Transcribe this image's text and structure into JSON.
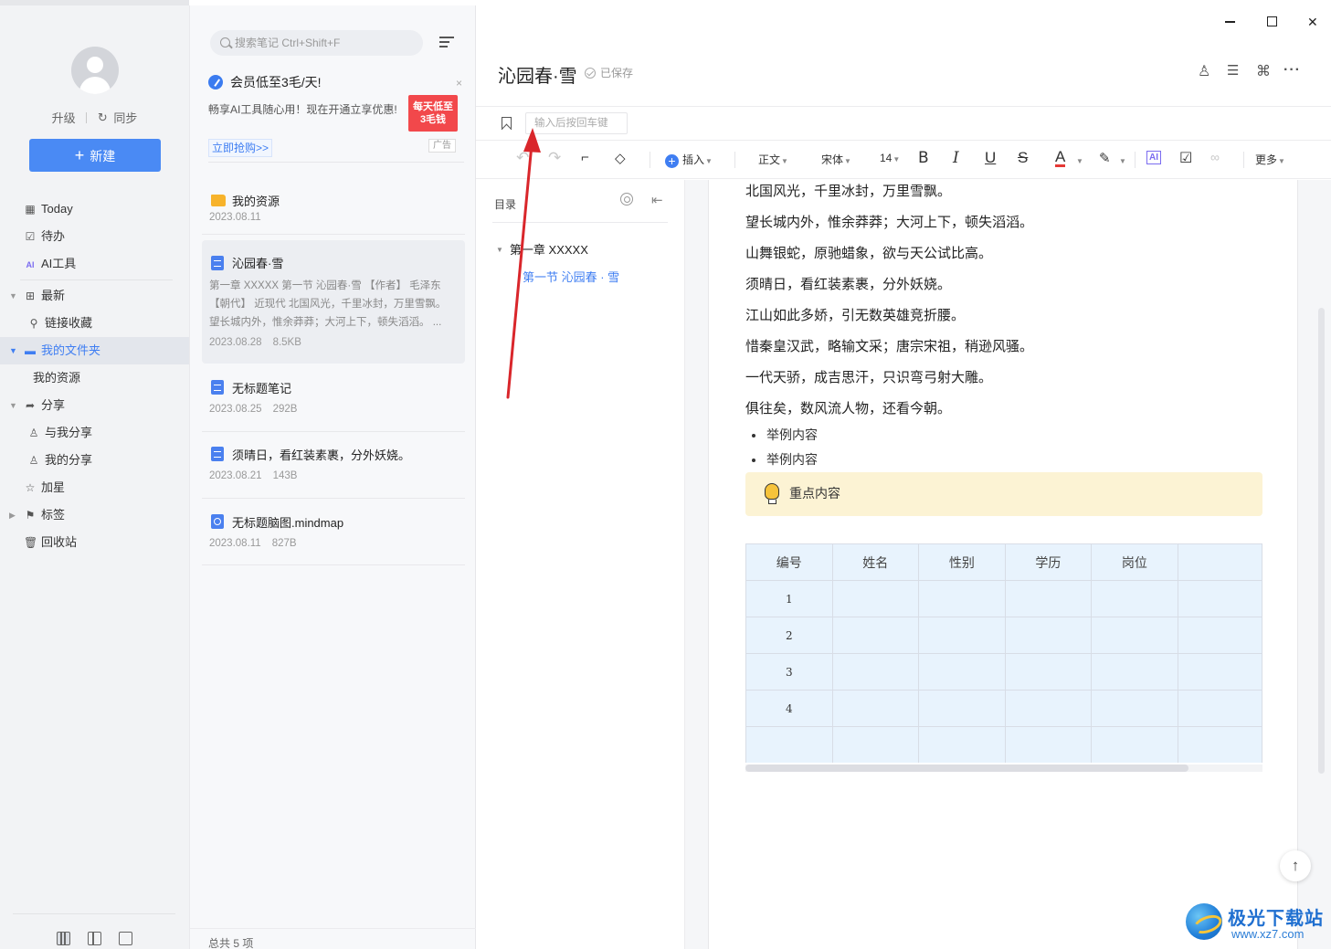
{
  "nav": {
    "upgrade": "升级",
    "sync": "同步",
    "new_label": "新建",
    "items": [
      {
        "label": "Today",
        "icon": "calendar-icon"
      },
      {
        "label": "待办",
        "icon": "checkbox-icon"
      },
      {
        "label": "AI工具",
        "icon": "ai-icon"
      },
      {
        "label": "最新",
        "icon": "grid-icon"
      },
      {
        "label": "链接收藏",
        "icon": "link-icon"
      },
      {
        "label": "我的文件夹",
        "icon": "folder-icon"
      },
      {
        "label": "我的资源",
        "icon": ""
      },
      {
        "label": "分享",
        "icon": "share-icon"
      },
      {
        "label": "与我分享",
        "icon": "user-icon"
      },
      {
        "label": "我的分享",
        "icon": "user-icon"
      },
      {
        "label": "加星",
        "icon": "star-icon"
      },
      {
        "label": "标签",
        "icon": "bookmark-icon"
      },
      {
        "label": "回收站",
        "icon": "trash-icon"
      }
    ]
  },
  "list": {
    "search_placeholder": "搜索笔记 Ctrl+Shift+F",
    "promo": {
      "title": "会员低至3毛/天!",
      "text": "畅享AI工具随心用！现在开通立享优惠!",
      "link": "立即抢购>>",
      "badge_line1": "每天低至",
      "badge_line2": "3毛钱",
      "ad": "广告",
      "close": "×"
    },
    "notes": [
      {
        "title": "我的资源",
        "date": "2023.08.11",
        "size": "",
        "body": ""
      },
      {
        "title": "沁园春·雪",
        "date": "2023.08.28",
        "size": "8.5KB",
        "body": "第一章 XXXXX 第一节 沁园春·雪 【作者】 毛泽东 【朝代】 近现代 北国风光，千里冰封，万里雪飘。望长城内外，惟余莽莽；大河上下，顿失滔滔。 ..."
      },
      {
        "title": "无标题笔记",
        "date": "2023.08.25",
        "size": "292B",
        "body": ""
      },
      {
        "title": "须晴日，看红装素裹，分外妖娆。",
        "date": "2023.08.21",
        "size": "143B",
        "body": ""
      },
      {
        "title": "无标题脑图.mindmap",
        "date": "2023.08.11",
        "size": "827B",
        "body": ""
      }
    ],
    "total": "总共 5 项"
  },
  "editor": {
    "title": "沁园春·雪",
    "saved": "已保存",
    "tag_placeholder": "输入后按回车键",
    "toolbar": {
      "insert": "插入",
      "paragraph": "正文",
      "font": "宋体",
      "size": "14",
      "more": "更多"
    },
    "toc": {
      "title": "目录",
      "h1": "第一章  XXXXX",
      "h2": "第一节 沁园春 · 雪"
    },
    "lines": [
      "北国风光，千里冰封，万里雪飘。",
      "望长城内外，惟余莽莽；大河上下，顿失滔滔。",
      "山舞银蛇，原驰蜡象，欲与天公试比高。",
      "须晴日，看红装素裹，分外妖娆。",
      "江山如此多娇，引无数英雄竞折腰。",
      "惜秦皇汉武，略输文采；唐宗宋祖，稍逊风骚。",
      "一代天骄，成吉思汗，只识弯弓射大雕。",
      "俱往矣，数风流人物，还看今朝。"
    ],
    "bullets": [
      "举例内容",
      "举例内容"
    ],
    "callout": "重点内容",
    "table": {
      "headers": [
        "编号",
        "姓名",
        "性别",
        "学历",
        "岗位"
      ],
      "rows": [
        [
          "1",
          "",
          "",
          "",
          ""
        ],
        [
          "2",
          "",
          "",
          "",
          ""
        ],
        [
          "3",
          "",
          "",
          "",
          ""
        ],
        [
          "4",
          "",
          "",
          "",
          ""
        ],
        [
          "",
          "",
          "",
          "",
          ""
        ]
      ]
    }
  },
  "watermark": {
    "name": "极光下载站",
    "url": "www.xz7.com"
  },
  "colors": {
    "accent": "#3f7ef2",
    "promo_badge": "#f2484b",
    "callout_bg": "#fcf3d4",
    "table_bg": "#e8f3fd",
    "annotation_arrow": "#d9262b"
  }
}
